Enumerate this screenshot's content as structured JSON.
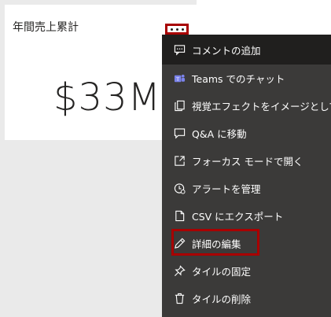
{
  "tile": {
    "title": "年間売上累計",
    "value": "$33M"
  },
  "menu": {
    "items": [
      {
        "label": "コメントの追加",
        "icon": "comment-icon"
      },
      {
        "label": "Teams でのチャット",
        "icon": "teams-icon"
      },
      {
        "label": "視覚エフェクトをイメージとしてコピー",
        "icon": "copy-icon"
      },
      {
        "label": "Q&A に移動",
        "icon": "qa-icon"
      },
      {
        "label": "フォーカス モードで開く",
        "icon": "focus-mode-icon"
      },
      {
        "label": "アラートを管理",
        "icon": "alert-icon"
      },
      {
        "label": "CSV にエクスポート",
        "icon": "export-csv-icon"
      },
      {
        "label": "詳細の編集",
        "icon": "pencil-icon"
      },
      {
        "label": "タイルの固定",
        "icon": "pin-icon"
      },
      {
        "label": "タイルの削除",
        "icon": "trash-icon"
      }
    ]
  },
  "colors": {
    "menu_bg": "#3b3a39",
    "menu_hover_bg": "#201f1e",
    "highlight_border": "#a80000",
    "icon_teams": "#7b83eb"
  }
}
